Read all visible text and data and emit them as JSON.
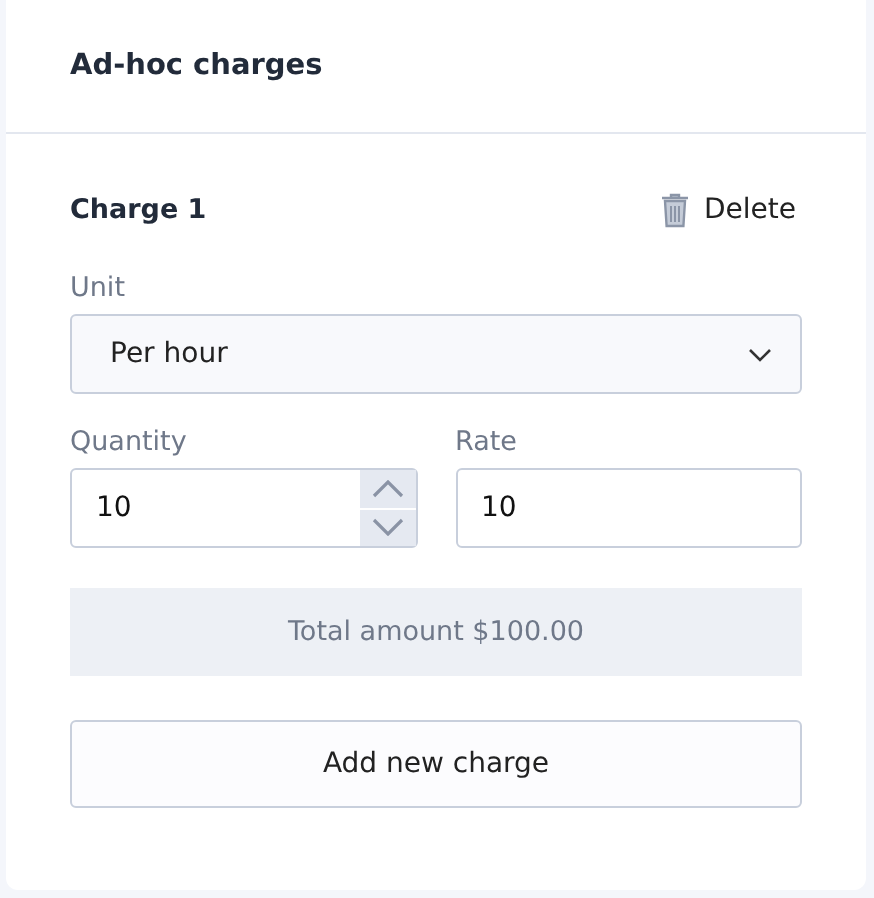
{
  "card": {
    "title": "Ad-hoc charges"
  },
  "charge": {
    "title": "Charge 1",
    "delete_label": "Delete",
    "unit": {
      "label": "Unit",
      "value": "Per hour"
    },
    "quantity": {
      "label": "Quantity",
      "value": "10"
    },
    "rate": {
      "label": "Rate",
      "value": "10"
    },
    "total": "Total amount $100.00"
  },
  "add_button": "Add new charge"
}
